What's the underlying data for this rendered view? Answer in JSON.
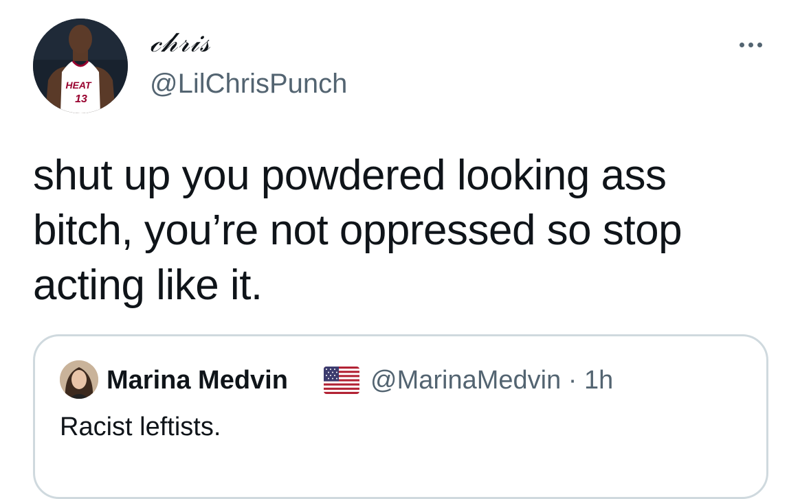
{
  "tweet": {
    "author": {
      "display_name": "𝒸𝒽𝓇𝒾𝓈",
      "handle": "@LilChrisPunch",
      "jersey_team": "HEAT",
      "jersey_number": "13"
    },
    "text": "shut up you powdered looking ass bitch, you’re not oppressed so stop acting like it.",
    "more_icon": "more-horizontal-icon"
  },
  "quoted_tweet": {
    "name": "Marina Medvin",
    "flag_icon": "us-flag-emoji",
    "meta": "@MarinaMedvin · 1h",
    "text": "Racist leftists."
  },
  "colors": {
    "text_primary": "#0f1419",
    "text_secondary": "#536471",
    "border": "#cfd9de",
    "jersey_red": "#98002e"
  }
}
